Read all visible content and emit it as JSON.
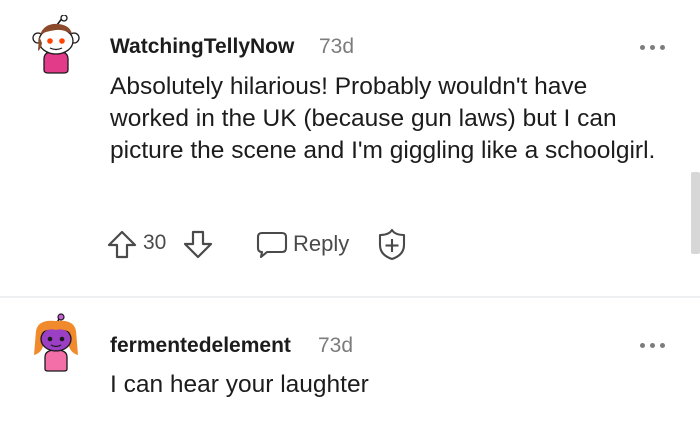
{
  "comments": [
    {
      "username": "WatchingTellyNow",
      "time": "73d",
      "body": "Absolutely hilarious! Probably wouldn't have worked in the UK (because gun laws) but I can picture the scene and I'm giggling like a schoolgirl.",
      "score": "30",
      "reply_label": "Reply"
    },
    {
      "username": "fermentedelement",
      "time": "73d",
      "body": "I can hear your laughter"
    }
  ],
  "colors": {
    "text": "#1c1c1c",
    "muted": "#7c7c7c",
    "icon": "#4a4a4a",
    "divider": "#edeff1"
  },
  "icons": [
    "snoo-avatar",
    "more-options-icon",
    "upvote-arrow-icon",
    "downvote-arrow-icon",
    "reply-bubble-icon",
    "award-icon"
  ]
}
